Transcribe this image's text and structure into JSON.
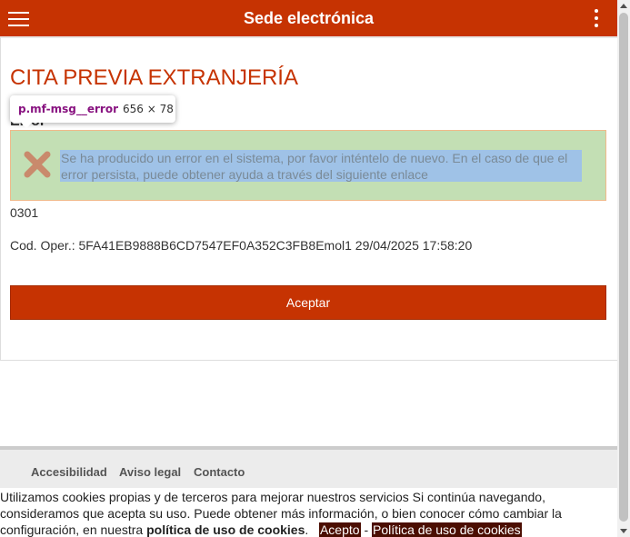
{
  "header": {
    "title": "Sede electrónica",
    "menu_icon": "hamburger-menu-icon",
    "more_icon": "more-vertical-icon",
    "bg_color": "#c63302"
  },
  "main": {
    "page_title": "CITA PREVIA EXTRANJERÍA",
    "section_label": "Error",
    "tooltip": {
      "selector": "p.mf-msg__error",
      "size": "656 × 78"
    },
    "error": {
      "icon": "error-x-icon",
      "message": "Se ha producido un error en el sistema, por favor inténtelo de nuevo. En el caso de que el error persista, puede obtener ayuda a través del siguiente enlace"
    },
    "code": "0301",
    "cod_oper": "Cod. Oper.: 5FA41EB9888B6CD7547EF0A352C3FB8Emol1 29/04/2025 17:58:20",
    "accept_label": "Aceptar"
  },
  "footer": {
    "links": [
      "Accesibilidad",
      "Aviso legal",
      "Contacto"
    ]
  },
  "cookies": {
    "text_1": "Utilizamos cookies propias y de terceros para mejorar nuestros servicios Si continúa navegando, consideramos que acepta su uso. Puede obtener más información, o bien conocer cómo cambiar la configuración, en nuestra ",
    "policy_bold": "política de uso de cookies",
    "text_2": ".",
    "accept": "Acepto",
    "separator": "-",
    "policy_link": "Política de uso de cookies"
  }
}
